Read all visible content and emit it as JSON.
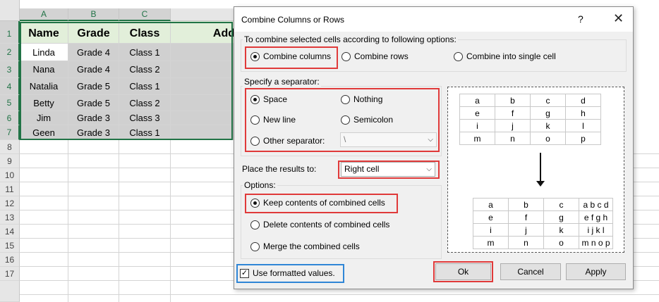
{
  "spreadsheet": {
    "columns": [
      "A",
      "B",
      "C"
    ],
    "rows": [
      "1",
      "2",
      "3",
      "4",
      "5",
      "6",
      "7",
      "8",
      "9",
      "10",
      "11",
      "12",
      "13",
      "14",
      "15",
      "16",
      "17"
    ],
    "headers": [
      "Name",
      "Grade",
      "Class",
      "Add"
    ],
    "data": [
      [
        "Linda",
        "Grade 4",
        "Class 1"
      ],
      [
        "Nana",
        "Grade 4",
        "Class 2"
      ],
      [
        "Natalia",
        "Grade 5",
        "Class 1"
      ],
      [
        "Betty",
        "Grade 5",
        "Class 2"
      ],
      [
        "Jim",
        "Grade 3",
        "Class 3"
      ],
      [
        "Geen",
        "Grade 3",
        "Class 1"
      ]
    ]
  },
  "dialog": {
    "title": "Combine Columns or Rows",
    "help": "?",
    "close": "✕",
    "combine_group_label": "To combine selected cells according to following options:",
    "combine_options": [
      "Combine columns",
      "Combine rows",
      "Combine into single cell"
    ],
    "separator_group_label": "Specify a separator:",
    "separator_options": [
      "Space",
      "Nothing",
      "New line",
      "Semicolon",
      "Other separator:"
    ],
    "other_separator_value": "\\",
    "place_label": "Place the results to:",
    "place_value": "Right cell",
    "options_group_label": "Options:",
    "options": [
      "Keep contents of combined cells",
      "Delete contents of combined cells",
      "Merge the combined cells"
    ],
    "use_formatted_label": "Use formatted values.",
    "buttons": {
      "ok": "Ok",
      "cancel": "Cancel",
      "apply": "Apply"
    },
    "preview_before": [
      [
        "a",
        "b",
        "c",
        "d"
      ],
      [
        "e",
        "f",
        "g",
        "h"
      ],
      [
        "i",
        "j",
        "k",
        "l"
      ],
      [
        "m",
        "n",
        "o",
        "p"
      ]
    ],
    "preview_after": [
      [
        "a",
        "b",
        "c",
        "a b c d"
      ],
      [
        "e",
        "f",
        "g",
        "e f g h"
      ],
      [
        "i",
        "j",
        "k",
        "i j k l"
      ],
      [
        "m",
        "n",
        "o",
        "m n o p"
      ]
    ]
  },
  "colors": {
    "selection": "#217346",
    "highlight_red": "#e03a3a",
    "highlight_blue": "#2f86d6"
  }
}
